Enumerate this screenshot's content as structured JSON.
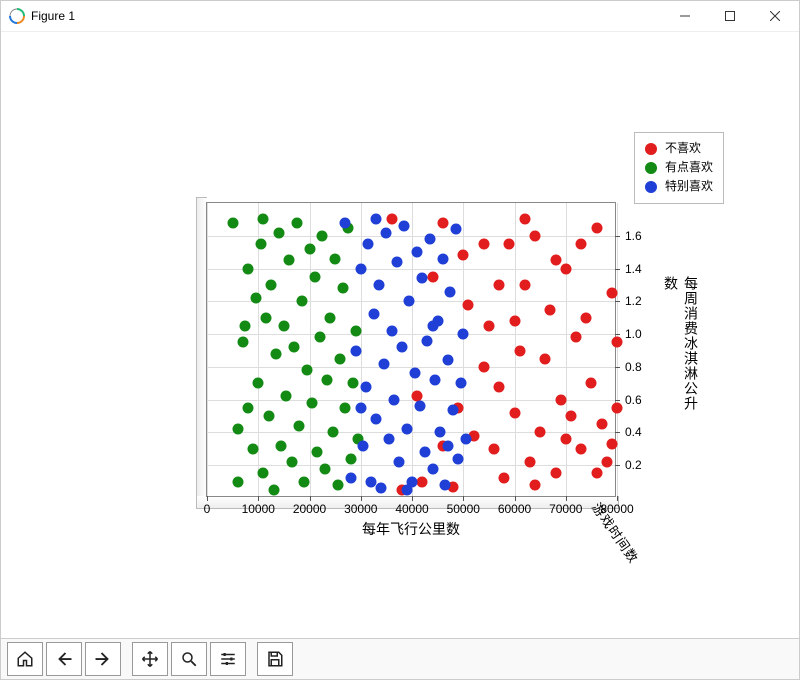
{
  "window": {
    "title": "Figure 1"
  },
  "legend": {
    "items": [
      {
        "label": "不喜欢",
        "color": "#e11d1d"
      },
      {
        "label": "有点喜欢",
        "color": "#138a13"
      },
      {
        "label": "特别喜欢",
        "color": "#1f3fd6"
      }
    ]
  },
  "chart_data": {
    "type": "scatter",
    "title": "",
    "xlabel": "每年飞行公里数",
    "ylabel": "每周消费冰淇淋公升数",
    "zlabel": "游戏时间数",
    "xlim": [
      0,
      80000
    ],
    "ylim": [
      0.0,
      1.8
    ],
    "xticks": [
      0,
      10000,
      20000,
      30000,
      40000,
      50000,
      60000,
      70000,
      80000
    ],
    "yticks": [
      0.2,
      0.4,
      0.6,
      0.8,
      1.0,
      1.2,
      1.4,
      1.6
    ],
    "series": [
      {
        "name": "不喜欢",
        "color": "#e11d1d",
        "points": [
          [
            36000,
            1.7
          ],
          [
            38000,
            0.05
          ],
          [
            42000,
            0.1
          ],
          [
            46000,
            1.68
          ],
          [
            48000,
            0.07
          ],
          [
            50000,
            1.48
          ],
          [
            52000,
            0.38
          ],
          [
            54000,
            0.8
          ],
          [
            55000,
            1.05
          ],
          [
            56000,
            0.3
          ],
          [
            57000,
            1.3
          ],
          [
            58000,
            0.12
          ],
          [
            59000,
            1.55
          ],
          [
            60000,
            0.52
          ],
          [
            61000,
            0.9
          ],
          [
            62000,
            1.3
          ],
          [
            63000,
            0.22
          ],
          [
            64000,
            1.6
          ],
          [
            65000,
            0.4
          ],
          [
            66000,
            0.85
          ],
          [
            67000,
            1.15
          ],
          [
            68000,
            0.15
          ],
          [
            69000,
            0.6
          ],
          [
            70000,
            1.4
          ],
          [
            71000,
            0.5
          ],
          [
            72000,
            0.98
          ],
          [
            73000,
            0.3
          ],
          [
            74000,
            1.1
          ],
          [
            75000,
            0.7
          ],
          [
            76000,
            1.65
          ],
          [
            77000,
            0.45
          ],
          [
            78000,
            0.22
          ],
          [
            79000,
            1.25
          ],
          [
            80000,
            0.55
          ],
          [
            80000,
            0.95
          ],
          [
            62000,
            1.7
          ],
          [
            54000,
            1.55
          ],
          [
            49000,
            0.55
          ],
          [
            44000,
            1.35
          ],
          [
            41000,
            0.62
          ],
          [
            46000,
            0.32
          ],
          [
            51000,
            1.18
          ],
          [
            57000,
            0.68
          ],
          [
            68000,
            1.45
          ],
          [
            73000,
            1.55
          ],
          [
            76000,
            0.15
          ],
          [
            79000,
            0.33
          ],
          [
            64000,
            0.08
          ],
          [
            70000,
            0.36
          ],
          [
            60000,
            1.08
          ]
        ]
      },
      {
        "name": "有点喜欢",
        "color": "#138a13",
        "points": [
          [
            5000,
            1.68
          ],
          [
            6000,
            0.1
          ],
          [
            7000,
            0.95
          ],
          [
            8000,
            1.4
          ],
          [
            9000,
            0.3
          ],
          [
            10000,
            0.7
          ],
          [
            10500,
            1.55
          ],
          [
            11000,
            0.15
          ],
          [
            11500,
            1.1
          ],
          [
            12000,
            0.5
          ],
          [
            12500,
            1.3
          ],
          [
            13000,
            0.05
          ],
          [
            13500,
            0.88
          ],
          [
            14000,
            1.62
          ],
          [
            14500,
            0.32
          ],
          [
            15000,
            1.05
          ],
          [
            15500,
            0.62
          ],
          [
            16000,
            1.45
          ],
          [
            16500,
            0.22
          ],
          [
            17000,
            0.92
          ],
          [
            17500,
            1.68
          ],
          [
            18000,
            0.44
          ],
          [
            18500,
            1.2
          ],
          [
            19000,
            0.1
          ],
          [
            19500,
            0.78
          ],
          [
            20000,
            1.52
          ],
          [
            20500,
            0.58
          ],
          [
            21000,
            1.35
          ],
          [
            21500,
            0.28
          ],
          [
            22000,
            0.98
          ],
          [
            22500,
            1.6
          ],
          [
            23000,
            0.18
          ],
          [
            23500,
            0.72
          ],
          [
            24000,
            1.1
          ],
          [
            24500,
            0.4
          ],
          [
            25000,
            1.46
          ],
          [
            25500,
            0.08
          ],
          [
            26000,
            0.85
          ],
          [
            26500,
            1.28
          ],
          [
            27000,
            0.55
          ],
          [
            27500,
            1.65
          ],
          [
            28000,
            0.24
          ],
          [
            28500,
            0.7
          ],
          [
            29000,
            1.02
          ],
          [
            29500,
            0.36
          ],
          [
            8000,
            0.55
          ],
          [
            9500,
            1.22
          ],
          [
            11000,
            1.7
          ],
          [
            6000,
            0.42
          ],
          [
            7500,
            1.05
          ]
        ]
      },
      {
        "name": "特别喜欢",
        "color": "#1f3fd6",
        "points": [
          [
            27000,
            1.68
          ],
          [
            28000,
            0.12
          ],
          [
            29000,
            0.9
          ],
          [
            30000,
            1.4
          ],
          [
            30500,
            0.32
          ],
          [
            31000,
            0.68
          ],
          [
            31500,
            1.55
          ],
          [
            32000,
            0.1
          ],
          [
            32500,
            1.12
          ],
          [
            33000,
            0.48
          ],
          [
            33500,
            1.3
          ],
          [
            34000,
            0.06
          ],
          [
            34500,
            0.82
          ],
          [
            35000,
            1.62
          ],
          [
            35500,
            0.36
          ],
          [
            36000,
            1.02
          ],
          [
            36500,
            0.6
          ],
          [
            37000,
            1.44
          ],
          [
            37500,
            0.22
          ],
          [
            38000,
            0.92
          ],
          [
            38500,
            1.66
          ],
          [
            39000,
            0.42
          ],
          [
            39500,
            1.2
          ],
          [
            40000,
            0.1
          ],
          [
            40500,
            0.76
          ],
          [
            41000,
            1.5
          ],
          [
            41500,
            0.56
          ],
          [
            42000,
            1.34
          ],
          [
            42500,
            0.28
          ],
          [
            43000,
            0.96
          ],
          [
            43500,
            1.58
          ],
          [
            44000,
            0.18
          ],
          [
            44500,
            0.72
          ],
          [
            45000,
            1.08
          ],
          [
            45500,
            0.4
          ],
          [
            46000,
            1.46
          ],
          [
            46500,
            0.08
          ],
          [
            47000,
            0.84
          ],
          [
            47500,
            1.26
          ],
          [
            48000,
            0.54
          ],
          [
            48500,
            1.64
          ],
          [
            49000,
            0.24
          ],
          [
            49500,
            0.7
          ],
          [
            50000,
            1.0
          ],
          [
            50500,
            0.36
          ],
          [
            30000,
            0.55
          ],
          [
            33000,
            1.7
          ],
          [
            44000,
            1.05
          ],
          [
            39000,
            0.05
          ],
          [
            47000,
            0.32
          ]
        ]
      }
    ]
  }
}
